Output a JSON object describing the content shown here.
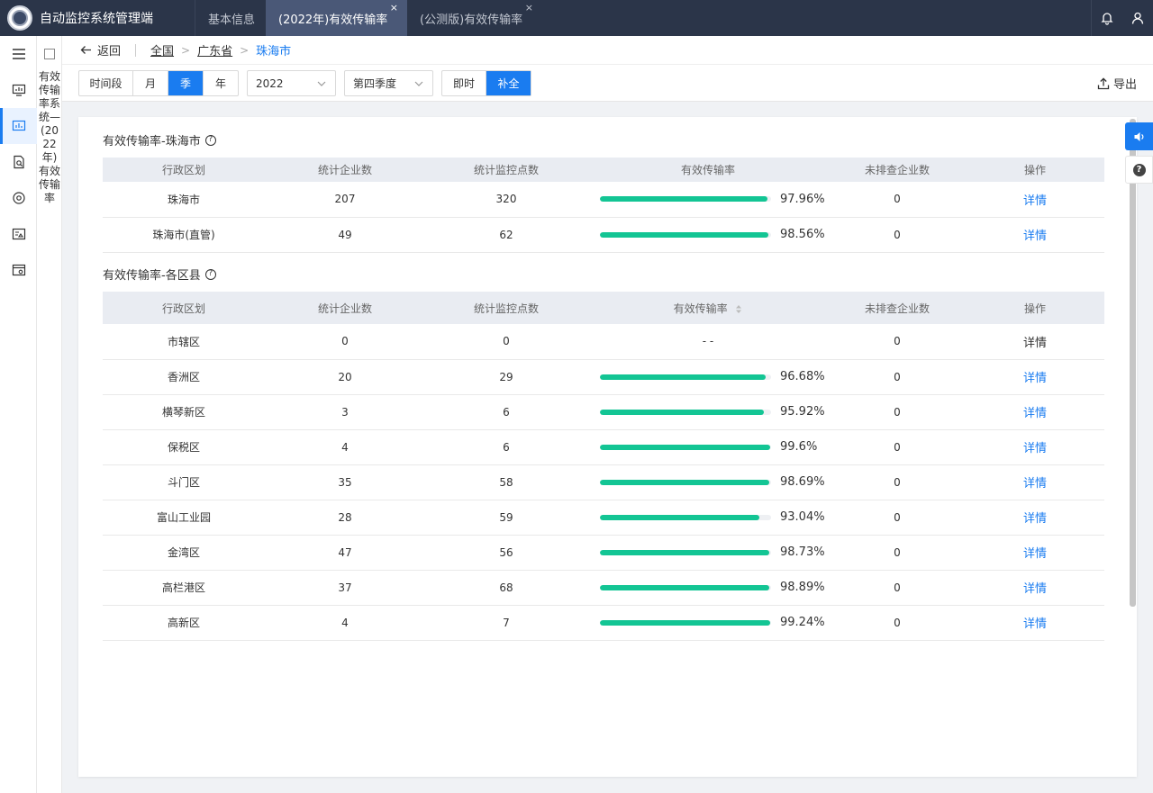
{
  "app": {
    "title": "自动监控系统管理端"
  },
  "tabs": [
    {
      "label": "基本信息",
      "closable": false,
      "active": false
    },
    {
      "label": "(2022年)有效传输率",
      "closable": true,
      "active": true
    },
    {
      "label": "(公测版)有效传输率",
      "closable": true,
      "active": false
    }
  ],
  "icons": {
    "close": "×"
  },
  "vertical_title": "有效传输率系统—(2022年)有效传输率",
  "breadcrumb": {
    "back_label": "返回",
    "items": [
      "全国",
      "广东省",
      "珠海市"
    ]
  },
  "filters": {
    "period_options": [
      "时间段",
      "月",
      "季",
      "年"
    ],
    "period_selected": "季",
    "year": "2022",
    "quarter": "第四季度",
    "mode_options": [
      "即时",
      "补全"
    ],
    "mode_selected": "补全",
    "export_label": "导出"
  },
  "section1": {
    "title": "有效传输率-珠海市",
    "columns": [
      "行政区划",
      "统计企业数",
      "统计监控点数",
      "有效传输率",
      "未排查企业数",
      "操作"
    ],
    "rows": [
      {
        "region": "珠海市",
        "companies": "207",
        "points": "320",
        "rate": 97.96,
        "rate_text": "97.96%",
        "unchecked": "0",
        "action": "详情"
      },
      {
        "region": "珠海市(直管)",
        "companies": "49",
        "points": "62",
        "rate": 98.56,
        "rate_text": "98.56%",
        "unchecked": "0",
        "action": "详情"
      }
    ]
  },
  "section2": {
    "title": "有效传输率-各区县",
    "columns": [
      "行政区划",
      "统计企业数",
      "统计监控点数",
      "有效传输率",
      "未排查企业数",
      "操作"
    ],
    "rows": [
      {
        "region": "市辖区",
        "companies": "0",
        "points": "0",
        "rate": null,
        "rate_text": "- -",
        "unchecked": "0",
        "action": "详情"
      },
      {
        "region": "香洲区",
        "companies": "20",
        "points": "29",
        "rate": 96.68,
        "rate_text": "96.68%",
        "unchecked": "0",
        "action": "详情"
      },
      {
        "region": "横琴新区",
        "companies": "3",
        "points": "6",
        "rate": 95.92,
        "rate_text": "95.92%",
        "unchecked": "0",
        "action": "详情"
      },
      {
        "region": "保税区",
        "companies": "4",
        "points": "6",
        "rate": 99.6,
        "rate_text": "99.6%",
        "unchecked": "0",
        "action": "详情"
      },
      {
        "region": "斗门区",
        "companies": "35",
        "points": "58",
        "rate": 98.69,
        "rate_text": "98.69%",
        "unchecked": "0",
        "action": "详情"
      },
      {
        "region": "富山工业园",
        "companies": "28",
        "points": "59",
        "rate": 93.04,
        "rate_text": "93.04%",
        "unchecked": "0",
        "action": "详情"
      },
      {
        "region": "金湾区",
        "companies": "47",
        "points": "56",
        "rate": 98.73,
        "rate_text": "98.73%",
        "unchecked": "0",
        "action": "详情"
      },
      {
        "region": "高栏港区",
        "companies": "37",
        "points": "68",
        "rate": 98.89,
        "rate_text": "98.89%",
        "unchecked": "0",
        "action": "详情"
      },
      {
        "region": "高新区",
        "companies": "4",
        "points": "7",
        "rate": 99.24,
        "rate_text": "99.24%",
        "unchecked": "0",
        "action": "详情"
      }
    ]
  },
  "colors": {
    "accent": "#1a7cf0",
    "bar": "#13c594",
    "topbar": "#2b3549"
  }
}
